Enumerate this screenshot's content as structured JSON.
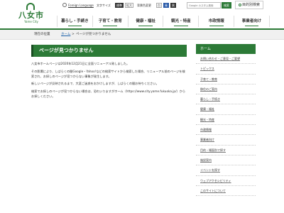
{
  "header": {
    "logo_text": "八女市",
    "logo_sub": "Yame City",
    "language_link": "Foreign Language",
    "font_size_label": "文字サイズ",
    "font_size_standard": "標準",
    "font_size_large": "拡大",
    "color_label": "背景色変更",
    "color_options": [
      "白",
      "青",
      "黒"
    ],
    "search_placeholder": "Google カスタム検索",
    "search_button": "検索",
    "clean_button": "目的別検索"
  },
  "nav": {
    "items": [
      "暮らし・手続き",
      "子育て・教育",
      "健康・福祉",
      "観光・特産",
      "市政情報",
      "事業者向け"
    ]
  },
  "breadcrumb": {
    "label": "現在の位置",
    "home": "ホーム",
    "separator": ">",
    "current": "ページが見つかりません"
  },
  "main": {
    "title": "ページが見つかりません",
    "paragraphs": [
      "八女市ホームページは2020年12月21日に全面リニューアル致しました。",
      "その影響により、しばらくの間Google・Yahoo!などの検索サイトから検索した場合、リニューアル前のページを検索され、お探しのページが見つからない事象が発生します。",
      "新しいページが反映されるまで、大変ご迷惑をおかけしますが、しばらくの間お待ちください。",
      "検索でお探しのページが見つからない場合は、恐れいりますがホーム（https://www.city.yame.fukuoka.jp/）からお探しください。"
    ]
  },
  "sidenav": {
    "head": "ホーム",
    "items": [
      "お問い合わせ・ご意見・ご要望",
      "トピックス",
      "子育て・教育",
      "移住のご案内",
      "暮らし・手続き",
      "健康・福祉",
      "観光・特産",
      "市政情報",
      "事業者向け",
      "目的・場面別で探す",
      "施設案内",
      "イベントを探す",
      "ウェブアクセシビリティ",
      "このサイトについて"
    ]
  },
  "colors": {
    "brand_green": "#2c7a37",
    "link_blue": "#1a5fa8"
  }
}
